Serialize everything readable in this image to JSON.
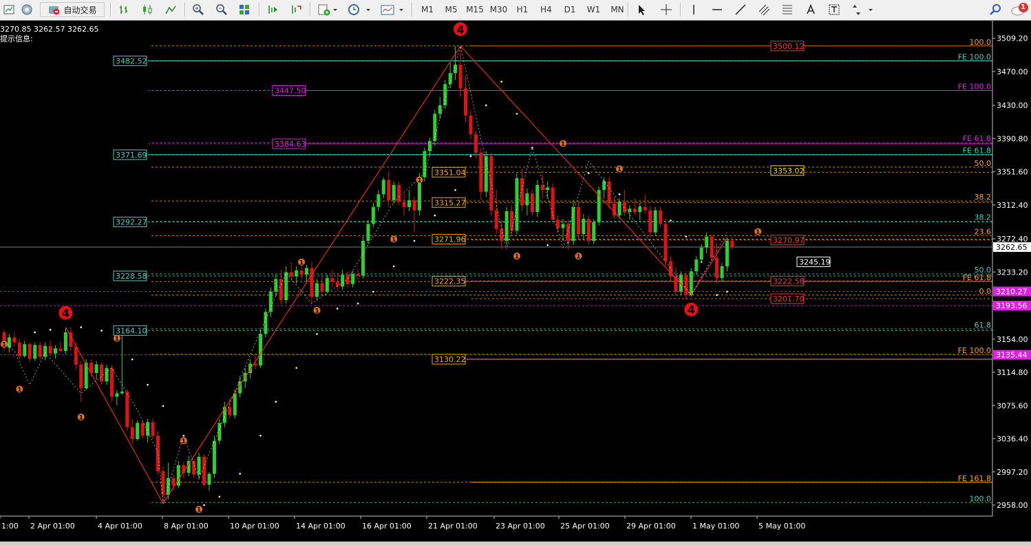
{
  "toolbar": {
    "auto_trade_label": "自动交易",
    "timeframes": [
      "M1",
      "M5",
      "M15",
      "M30",
      "H1",
      "H4",
      "D1",
      "W1",
      "MN"
    ],
    "notification_count": "1",
    "colors": {
      "bg": "#f0f0f0",
      "bull": "#2dd12d",
      "bear": "#e01212"
    }
  },
  "info": {
    "ohlc_line": "3270.85 3262.57 3262.65",
    "hint_label": "提示信息:"
  },
  "chart_data": {
    "type": "candlestick",
    "y_axis": {
      "ticks": [
        "3509.20",
        "3470.00",
        "3430.00",
        "3390.80",
        "3351.60",
        "3312.40",
        "3272.40",
        "3233.20",
        "3193.56",
        "3154.00",
        "3114.80",
        "3075.60",
        "3036.40",
        "2997.20",
        "2958.00"
      ],
      "current_price": "3262.65",
      "range": [
        2945,
        3530
      ]
    },
    "x_axis": {
      "labels": [
        "1:00",
        "2 Apr 01:00",
        "4 Apr 01:00",
        "8 Apr 01:00",
        "10 Apr 01:00",
        "14 Apr 01:00",
        "16 Apr 01:00",
        "21 Apr 01:00",
        "23 Apr 01:00",
        "25 Apr 01:00",
        "29 Apr 01:00",
        "1 May 01:00",
        "5 May 01:00"
      ]
    },
    "left_price_labels": [
      {
        "text": "3482.52",
        "value": 3482.52,
        "color": "#40d0c0"
      },
      {
        "text": "3447.50",
        "value": 3447.5,
        "color": "#e020e0"
      },
      {
        "text": "3384.63",
        "value": 3384.63,
        "color": "#e020e0"
      },
      {
        "text": "3371.69",
        "value": 3371.69,
        "color": "#40d0c0"
      },
      {
        "text": "3292.27",
        "value": 3292.27,
        "color": "#40d0c0"
      },
      {
        "text": "3228.58",
        "value": 3228.58,
        "color": "#40d0c0"
      },
      {
        "text": "3164.10",
        "value": 3164.1,
        "color": "#40d0c0"
      }
    ],
    "mid_price_labels": [
      {
        "text": "3351.04",
        "value": 3351.04
      },
      {
        "text": "3315.27",
        "value": 3315.27
      },
      {
        "text": "3271.96",
        "value": 3271.96
      },
      {
        "text": "3222.35",
        "value": 3222.35
      },
      {
        "text": "3130.22",
        "value": 3130.22
      }
    ],
    "right_box_labels": [
      {
        "text": "3500.12",
        "value": 3500.12,
        "color": "#ff3030"
      },
      {
        "text": "3353.02",
        "value": 3353.02,
        "color": "#ffd700"
      },
      {
        "text": "3270.97",
        "value": 3270.97,
        "color": "#ff3030"
      },
      {
        "text": "3245.19",
        "value": 3245.19,
        "color": "#ffffff"
      },
      {
        "text": "3222.58",
        "value": 3222.58,
        "color": "#ff3030"
      },
      {
        "text": "3201.70",
        "value": 3201.7,
        "color": "#ff3030"
      }
    ],
    "axis_badges": [
      {
        "text": "3210.27",
        "value": 3210.27,
        "color": "#e020e0"
      },
      {
        "text": "3193.56",
        "value": 3193.56,
        "color": "#e020e0"
      },
      {
        "text": "3135.44",
        "value": 3135.44,
        "color": "#e020e0"
      }
    ],
    "fib_right_labels": [
      {
        "text": "100.0",
        "value": 3500.12,
        "color": "#ffa500"
      },
      {
        "text": "FE 100.0",
        "value": 3482.52,
        "color": "#40d0c0"
      },
      {
        "text": "FE 100.0",
        "value": 3447.5,
        "color": "#e020e0"
      },
      {
        "text": "FE 61.8",
        "value": 3386,
        "color": "#e020e0"
      },
      {
        "text": "FE 61.8",
        "value": 3372,
        "color": "#40d0c0"
      },
      {
        "text": "50.0",
        "value": 3357,
        "color": "#ffa500"
      },
      {
        "text": "38.2",
        "value": 3317,
        "color": "#ffa500"
      },
      {
        "text": "38.2",
        "value": 3293,
        "color": "#40d0c0"
      },
      {
        "text": "23.6",
        "value": 3276,
        "color": "#ffa500"
      },
      {
        "text": "50.0",
        "value": 3231,
        "color": "#40d0c0"
      },
      {
        "text": "FE 61.8",
        "value": 3222,
        "color": "#ffa500"
      },
      {
        "text": "0.0",
        "value": 3206,
        "color": "#ffa500"
      },
      {
        "text": "61.8",
        "value": 3166,
        "color": "#40d0c0"
      },
      {
        "text": "FE 100.0",
        "value": 3136,
        "color": "#ffa500"
      },
      {
        "text": "FE 161.8",
        "value": 2985,
        "color": "#ffa500"
      },
      {
        "text": "100.0",
        "value": 2961,
        "color": "#40d0c0"
      }
    ],
    "wave_markers": [
      {
        "label": "4",
        "bar": 89,
        "price": 3520
      },
      {
        "label": "4",
        "bar": 12,
        "price": 3185
      },
      {
        "label": "4",
        "bar": 134,
        "price": 3189
      }
    ],
    "candles": [
      [
        3162,
        3165,
        3140,
        3144
      ],
      [
        3144,
        3160,
        3138,
        3156
      ],
      [
        3156,
        3162,
        3145,
        3150
      ],
      [
        3150,
        3154,
        3130,
        3134
      ],
      [
        3134,
        3152,
        3132,
        3148
      ],
      [
        3148,
        3150,
        3128,
        3131
      ],
      [
        3131,
        3150,
        3128,
        3147
      ],
      [
        3147,
        3151,
        3130,
        3133
      ],
      [
        3133,
        3150,
        3129,
        3146
      ],
      [
        3146,
        3152,
        3134,
        3137
      ],
      [
        3137,
        3147,
        3131,
        3143
      ],
      [
        3143,
        3151,
        3138,
        3140
      ],
      [
        3140,
        3168,
        3136,
        3162
      ],
      [
        3162,
        3168,
        3140,
        3145
      ],
      [
        3145,
        3150,
        3118,
        3124
      ],
      [
        3124,
        3128,
        3080,
        3096
      ],
      [
        3096,
        3130,
        3094,
        3126
      ],
      [
        3126,
        3130,
        3110,
        3114
      ],
      [
        3114,
        3128,
        3106,
        3124
      ],
      [
        3124,
        3126,
        3100,
        3104
      ],
      [
        3104,
        3124,
        3100,
        3120
      ],
      [
        3120,
        3123,
        3080,
        3086
      ],
      [
        3086,
        3094,
        3076,
        3090
      ],
      [
        3090,
        3160,
        3088,
        3092
      ],
      [
        3092,
        3095,
        3046,
        3050
      ],
      [
        3050,
        3060,
        3030,
        3036
      ],
      [
        3036,
        3058,
        3034,
        3055
      ],
      [
        3055,
        3058,
        3036,
        3040
      ],
      [
        3040,
        3060,
        3032,
        3056
      ],
      [
        3056,
        3060,
        3036,
        3040
      ],
      [
        3040,
        3045,
        2994,
        2998
      ],
      [
        2998,
        3004,
        2960,
        2970
      ],
      [
        2970,
        3008,
        2965,
        2990
      ],
      [
        2990,
        2994,
        2975,
        2981
      ],
      [
        2981,
        3010,
        2978,
        3005
      ],
      [
        3005,
        3009,
        2990,
        2996
      ],
      [
        2996,
        3016,
        2992,
        3010
      ],
      [
        3010,
        3013,
        2990,
        2994
      ],
      [
        2994,
        3020,
        2988,
        3015
      ],
      [
        3015,
        3018,
        2980,
        2982
      ],
      [
        2982,
        2997,
        2975,
        2995
      ],
      [
        2995,
        3040,
        2990,
        3034
      ],
      [
        3034,
        3060,
        3030,
        3055
      ],
      [
        3055,
        3080,
        3050,
        3074
      ],
      [
        3074,
        3083,
        3060,
        3064
      ],
      [
        3064,
        3095,
        3060,
        3090
      ],
      [
        3090,
        3110,
        3085,
        3104
      ],
      [
        3104,
        3120,
        3096,
        3114
      ],
      [
        3114,
        3130,
        3108,
        3125
      ],
      [
        3125,
        3135,
        3118,
        3123
      ],
      [
        3123,
        3165,
        3120,
        3160
      ],
      [
        3160,
        3190,
        3156,
        3186
      ],
      [
        3186,
        3215,
        3180,
        3210
      ],
      [
        3210,
        3230,
        3205,
        3225
      ],
      [
        3225,
        3236,
        3195,
        3200
      ],
      [
        3200,
        3240,
        3196,
        3233
      ],
      [
        3233,
        3245,
        3224,
        3228
      ],
      [
        3228,
        3240,
        3220,
        3235
      ],
      [
        3235,
        3248,
        3225,
        3230
      ],
      [
        3230,
        3242,
        3222,
        3238
      ],
      [
        3238,
        3245,
        3196,
        3204
      ],
      [
        3204,
        3225,
        3200,
        3220
      ],
      [
        3220,
        3228,
        3205,
        3210
      ],
      [
        3210,
        3230,
        3208,
        3226
      ],
      [
        3226,
        3235,
        3215,
        3222
      ],
      [
        3222,
        3232,
        3212,
        3216
      ],
      [
        3216,
        3236,
        3212,
        3230
      ],
      [
        3230,
        3234,
        3215,
        3219
      ],
      [
        3219,
        3235,
        3215,
        3231
      ],
      [
        3231,
        3236,
        3224,
        3229
      ],
      [
        3229,
        3275,
        3226,
        3270
      ],
      [
        3270,
        3295,
        3266,
        3290
      ],
      [
        3290,
        3315,
        3286,
        3310
      ],
      [
        3310,
        3330,
        3305,
        3325
      ],
      [
        3325,
        3345,
        3320,
        3342
      ],
      [
        3342,
        3352,
        3310,
        3318
      ],
      [
        3318,
        3340,
        3314,
        3336
      ],
      [
        3336,
        3340,
        3312,
        3316
      ],
      [
        3316,
        3326,
        3300,
        3310
      ],
      [
        3310,
        3330,
        3305,
        3318
      ],
      [
        3318,
        3322,
        3280,
        3306
      ],
      [
        3306,
        3350,
        3300,
        3345
      ],
      [
        3345,
        3380,
        3340,
        3376
      ],
      [
        3376,
        3392,
        3370,
        3388
      ],
      [
        3388,
        3425,
        3382,
        3420
      ],
      [
        3420,
        3440,
        3414,
        3430
      ],
      [
        3430,
        3460,
        3426,
        3455
      ],
      [
        3455,
        3480,
        3450,
        3468
      ],
      [
        3468,
        3500,
        3460,
        3478
      ],
      [
        3478,
        3500,
        3440,
        3450
      ],
      [
        3450,
        3465,
        3410,
        3418
      ],
      [
        3418,
        3424,
        3390,
        3396
      ],
      [
        3396,
        3400,
        3368,
        3374
      ],
      [
        3374,
        3380,
        3318,
        3328
      ],
      [
        3328,
        3376,
        3322,
        3370
      ],
      [
        3370,
        3374,
        3300,
        3306
      ],
      [
        3306,
        3330,
        3278,
        3284
      ],
      [
        3284,
        3295,
        3260,
        3270
      ],
      [
        3270,
        3310,
        3265,
        3305
      ],
      [
        3305,
        3312,
        3276,
        3282
      ],
      [
        3282,
        3350,
        3278,
        3344
      ],
      [
        3344,
        3355,
        3305,
        3312
      ],
      [
        3312,
        3332,
        3300,
        3326
      ],
      [
        3326,
        3330,
        3300,
        3304
      ],
      [
        3304,
        3342,
        3298,
        3336
      ],
      [
        3336,
        3348,
        3320,
        3330
      ],
      [
        3330,
        3340,
        3320,
        3333
      ],
      [
        3333,
        3338,
        3290,
        3295
      ],
      [
        3295,
        3300,
        3280,
        3285
      ],
      [
        3285,
        3296,
        3270,
        3290
      ],
      [
        3290,
        3295,
        3260,
        3270
      ],
      [
        3270,
        3318,
        3265,
        3310
      ],
      [
        3310,
        3316,
        3272,
        3278
      ],
      [
        3278,
        3302,
        3272,
        3296
      ],
      [
        3296,
        3300,
        3266,
        3270
      ],
      [
        3270,
        3296,
        3266,
        3292
      ],
      [
        3292,
        3334,
        3288,
        3330
      ],
      [
        3330,
        3345,
        3320,
        3340
      ],
      [
        3340,
        3346,
        3308,
        3314
      ],
      [
        3314,
        3322,
        3296,
        3300
      ],
      [
        3300,
        3320,
        3296,
        3316
      ],
      [
        3316,
        3330,
        3300,
        3304
      ],
      [
        3304,
        3312,
        3295,
        3308
      ],
      [
        3308,
        3320,
        3300,
        3304
      ],
      [
        3304,
        3315,
        3294,
        3310
      ],
      [
        3310,
        3325,
        3302,
        3306
      ],
      [
        3306,
        3312,
        3275,
        3280
      ],
      [
        3280,
        3310,
        3276,
        3306
      ],
      [
        3306,
        3310,
        3286,
        3290
      ],
      [
        3290,
        3296,
        3240,
        3246
      ],
      [
        3246,
        3252,
        3222,
        3228
      ],
      [
        3228,
        3238,
        3205,
        3210
      ],
      [
        3210,
        3234,
        3206,
        3230
      ],
      [
        3230,
        3234,
        3200,
        3206
      ],
      [
        3206,
        3238,
        3204,
        3234
      ],
      [
        3234,
        3252,
        3230,
        3248
      ],
      [
        3248,
        3266,
        3244,
        3262
      ],
      [
        3262,
        3280,
        3255,
        3275
      ],
      [
        3275,
        3278,
        3244,
        3250
      ],
      [
        3250,
        3268,
        3220,
        3226
      ],
      [
        3226,
        3244,
        3222,
        3240
      ],
      [
        3240,
        3274,
        3234,
        3270
      ],
      [
        3270,
        3274,
        3260,
        3262
      ]
    ],
    "zigzag_bars": [
      [
        12,
        3168
      ],
      [
        31,
        2960
      ],
      [
        89,
        3500
      ],
      [
        134,
        3206
      ],
      [
        141,
        3274
      ]
    ],
    "wave_points": [
      [
        0,
        3150
      ],
      [
        2,
        3140
      ],
      [
        5,
        3100
      ],
      [
        8,
        3138
      ],
      [
        15,
        3090
      ],
      [
        21,
        3120
      ],
      [
        26,
        3070
      ],
      [
        30,
        3020
      ],
      [
        31,
        2960
      ],
      [
        35,
        3040
      ],
      [
        38,
        2990
      ],
      [
        49,
        3150
      ],
      [
        55,
        3232
      ],
      [
        60,
        3196
      ],
      [
        67,
        3225
      ],
      [
        76,
        3316
      ],
      [
        82,
        3350
      ],
      [
        89,
        3500
      ],
      [
        93,
        3390
      ],
      [
        98,
        3260
      ],
      [
        103,
        3380
      ],
      [
        109,
        3262
      ],
      [
        114,
        3364
      ],
      [
        134,
        3206
      ],
      [
        141,
        3280
      ]
    ],
    "sar_points": [
      [
        6,
        3162
      ],
      [
        9,
        3165
      ],
      [
        12,
        3146
      ],
      [
        15,
        3168
      ],
      [
        19,
        3164
      ],
      [
        22,
        3154
      ],
      [
        25,
        3130
      ],
      [
        28,
        3100
      ],
      [
        31,
        3075
      ],
      [
        35,
        3040
      ],
      [
        39,
        2958
      ],
      [
        42,
        2968
      ],
      [
        46,
        2995
      ],
      [
        50,
        3040
      ],
      [
        53,
        3080
      ],
      [
        57,
        3120
      ],
      [
        61,
        3160
      ],
      [
        65,
        3190
      ],
      [
        69,
        3196
      ],
      [
        72,
        3210
      ],
      [
        76,
        3240
      ],
      [
        80,
        3270
      ],
      [
        84,
        3300
      ],
      [
        88,
        3330
      ],
      [
        91,
        3370
      ],
      [
        94,
        3430
      ],
      [
        97,
        3458
      ],
      [
        100,
        3420
      ],
      [
        103,
        3380
      ],
      [
        106,
        3265
      ],
      [
        110,
        3268
      ],
      [
        114,
        3350
      ],
      [
        117,
        3340
      ],
      [
        120,
        3325
      ],
      [
        124,
        3310
      ],
      [
        128,
        3300
      ],
      [
        130,
        3294
      ],
      [
        133,
        3275
      ],
      [
        136,
        3245
      ],
      [
        139,
        3206
      ],
      [
        141,
        3210
      ]
    ]
  }
}
